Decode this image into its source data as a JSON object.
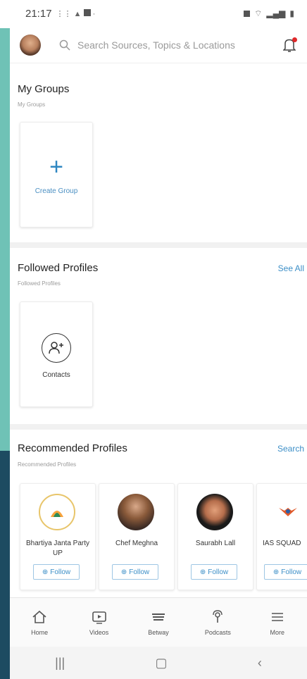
{
  "status_bar": {
    "time": "21:17"
  },
  "search": {
    "placeholder": "Search Sources, Topics & Locations"
  },
  "my_groups": {
    "title": "My Groups",
    "subtitle": "My Groups",
    "create_label": "Create Group"
  },
  "followed_profiles": {
    "title": "Followed Profiles",
    "subtitle": "Followed Profiles",
    "see_all": "See All",
    "contacts_label": "Contacts"
  },
  "recommended_profiles": {
    "title": "Recommended Profiles",
    "subtitle": "Recommended Profiles",
    "search_link": "Search",
    "follow_label": "Follow",
    "profiles": [
      {
        "name": "Bhartiya Janta Party UP"
      },
      {
        "name": "Chef Meghna"
      },
      {
        "name": "Saurabh Lall"
      },
      {
        "name": "IAS SQUAD"
      }
    ]
  },
  "bottom_nav": {
    "items": [
      {
        "label": "Home",
        "icon": "home-icon"
      },
      {
        "label": "Videos",
        "icon": "video-icon"
      },
      {
        "label": "Betway",
        "icon": "betway-icon"
      },
      {
        "label": "Podcasts",
        "icon": "podcast-icon"
      },
      {
        "label": "More",
        "icon": "menu-icon"
      }
    ]
  },
  "colors": {
    "accent": "#3d8fc7",
    "side_teal": "#6fc2b6",
    "side_navy": "#1d4b61",
    "notification": "#e0292b"
  }
}
